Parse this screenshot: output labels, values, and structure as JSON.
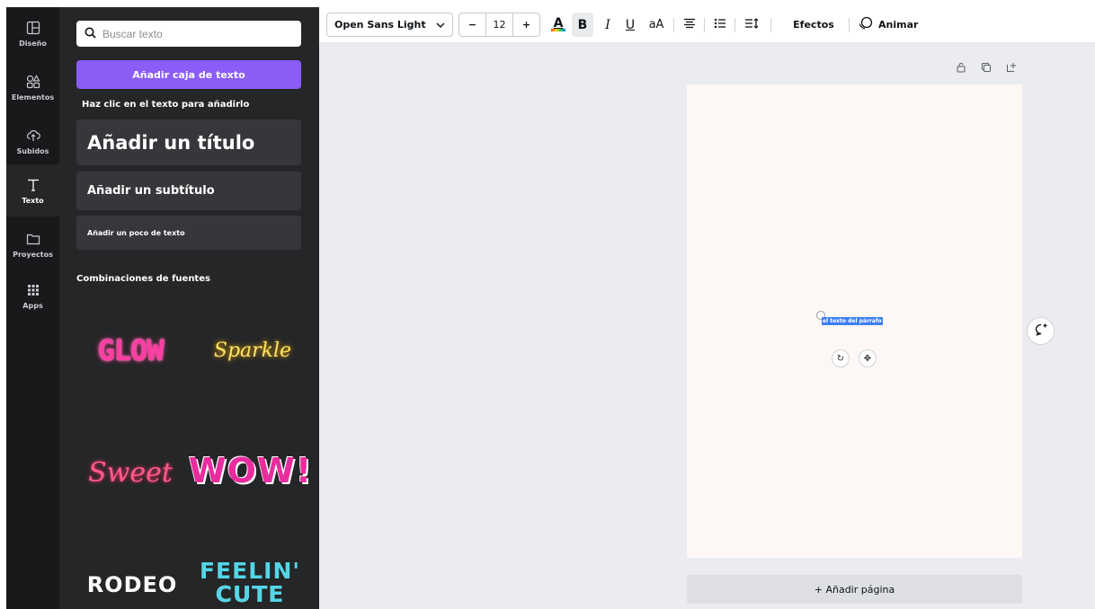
{
  "rail": {
    "items": [
      {
        "label": "Diseño",
        "icon": "layout-icon"
      },
      {
        "label": "Elementos",
        "icon": "shapes-icon"
      },
      {
        "label": "Subidos",
        "icon": "cloud-upload-icon"
      },
      {
        "label": "Texto",
        "icon": "text-icon"
      },
      {
        "label": "Proyectos",
        "icon": "folder-icon"
      },
      {
        "label": "Apps",
        "icon": "grid-icon"
      }
    ]
  },
  "panel": {
    "search_placeholder": "Buscar texto",
    "add_box_label": "Añadir caja de texto",
    "hint": "Haz clic en el texto para añadirlo",
    "title_card": "Añadir un título",
    "subtitle_card": "Añadir un subtítulo",
    "body_card": "Añadir un poco de texto",
    "combos_heading": "Combinaciones de fuentes",
    "presets": {
      "glow": "GLOW",
      "sparkle": "Sparkle",
      "sweet": "Sweet",
      "wow": "WOW!",
      "rodeo": "RODEO",
      "feelin_line1": "FEELIN'",
      "feelin_line2": "CUTE"
    }
  },
  "toolbar": {
    "font_name": "Open Sans Light",
    "font_size": "12",
    "minus": "−",
    "plus": "+",
    "text_color_glyph": "A",
    "bold_glyph": "B",
    "italic_glyph": "I",
    "underline_glyph": "U",
    "case_label": "aA",
    "effects_label": "Efectos",
    "animate_label": "Animar"
  },
  "canvas": {
    "selected_text": "el texto del párrafo",
    "add_page_label": "+ Añadir página"
  },
  "colors": {
    "accent": "#8b5cf6",
    "selection": "#3d7ff5",
    "panel_bg": "#252627",
    "rail_bg": "#18191b",
    "page_bg": "#fdf7f6"
  }
}
